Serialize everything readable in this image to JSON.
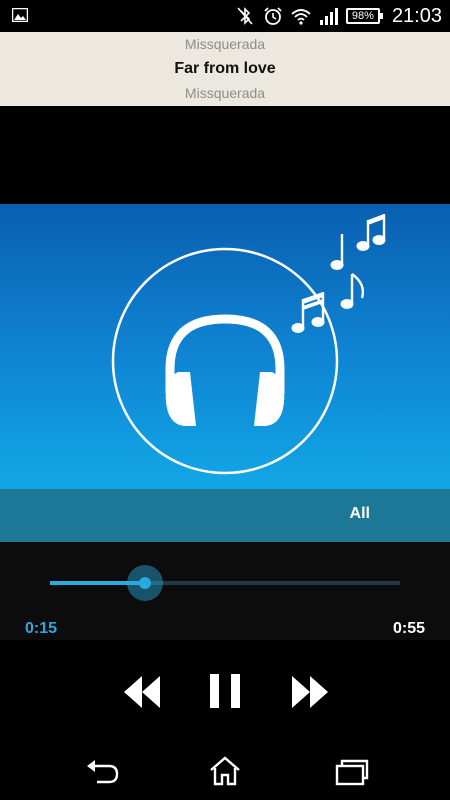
{
  "status_bar": {
    "left_icon": "image-notification-icon",
    "icons": [
      "bluetooth-off-icon",
      "alarm-clock-icon",
      "wifi-icon",
      "signal-icon"
    ],
    "battery": "98%",
    "time": "21:03"
  },
  "now_playing": {
    "artist": "Missquerada",
    "title": "Far from love",
    "album": "Missquerada"
  },
  "artwork": {
    "icon": "headphones-icon",
    "decoration": "music-notes-icon"
  },
  "playlist": {
    "mode": "All"
  },
  "playback": {
    "current_time": "0:15",
    "total_time": "0:55",
    "progress_fraction": 0.27
  },
  "controls": {
    "rewind": "rewind-icon",
    "pause": "pause-icon",
    "fast_forward": "fast-forward-icon"
  },
  "nav_bar": {
    "back": "back-icon",
    "home": "home-icon",
    "recents": "recents-icon"
  },
  "colors": {
    "accent": "#2aa9df",
    "header_bg": "#ece8df",
    "playlist_bar": "#1d7797"
  }
}
